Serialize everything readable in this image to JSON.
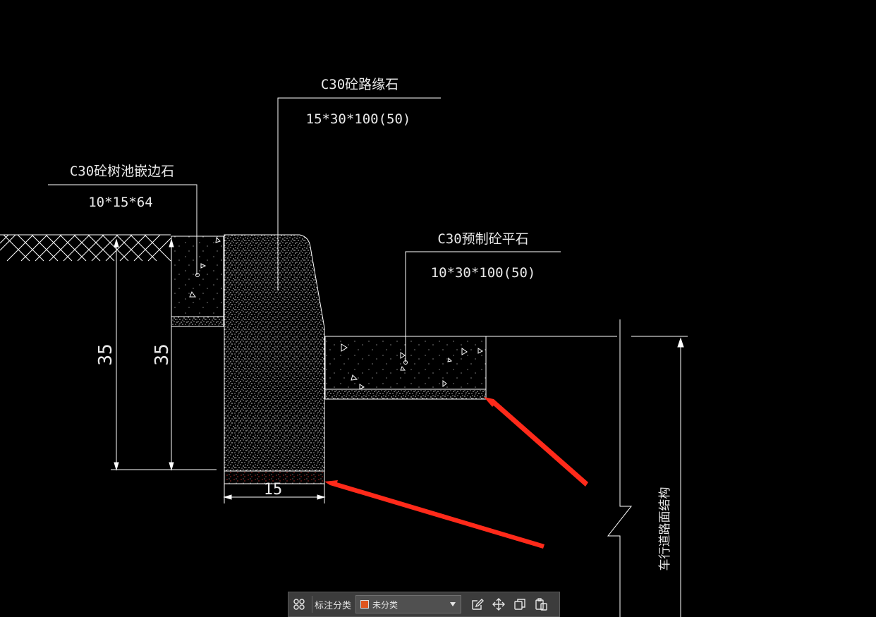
{
  "drawing": {
    "labels": {
      "curb": {
        "title": "C30砼路缘石",
        "spec": "15*30*100(50)"
      },
      "tree_edge": {
        "title": "C30砼树池嵌边石",
        "spec": "10*15*64"
      },
      "flat_stone": {
        "title": "C30预制砼平石",
        "spec": "10*30*100(50)"
      }
    },
    "dimensions": {
      "height_left": "35",
      "height_inner": "35",
      "width_bottom": "15"
    },
    "vertical_label": "车行道路面结构"
  },
  "toolbar": {
    "category_label": "标注分类",
    "category_value": "未分类",
    "category_color": "#e0551e",
    "icons": [
      "grid-icon",
      "edit-icon",
      "move-icon",
      "copy-icon",
      "paste-icon"
    ]
  },
  "colors": {
    "background": "#000000",
    "lines": "#ffffff",
    "arrow": "#ff2a1a"
  }
}
